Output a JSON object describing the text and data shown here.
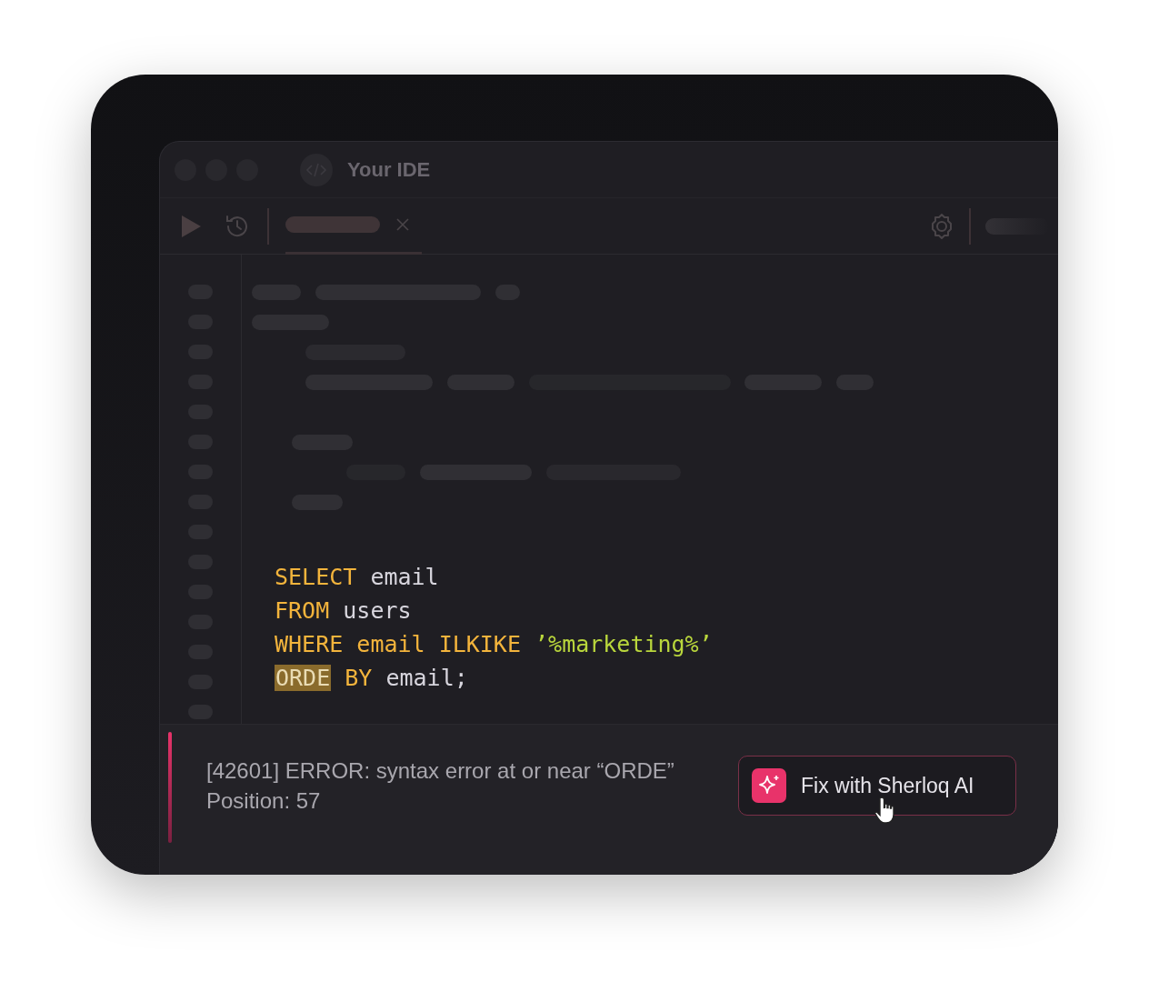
{
  "window": {
    "title": "Your IDE"
  },
  "editor": {
    "lines": [
      [
        {
          "text": "SELECT",
          "kind": "keyword"
        },
        {
          "text": "email",
          "kind": "ident"
        }
      ],
      [
        {
          "text": "FROM",
          "kind": "keyword"
        },
        {
          "text": "users",
          "kind": "ident"
        }
      ],
      [
        {
          "text": "WHERE",
          "kind": "keyword"
        },
        {
          "text": "email",
          "kind": "keyword"
        },
        {
          "text": "ILKIKE",
          "kind": "keyword"
        },
        {
          "text": "’%marketing%’",
          "kind": "string"
        }
      ],
      [
        {
          "text": "ORDE",
          "kind": "error"
        },
        {
          "text": "BY",
          "kind": "keyword"
        },
        {
          "text": "email;",
          "kind": "ident"
        }
      ]
    ]
  },
  "error": {
    "message": "[42601] ERROR: syntax error at or near “ORDE”",
    "position": "Position: 57"
  },
  "fix_button": {
    "label": "Fix with Sherloq AI"
  }
}
